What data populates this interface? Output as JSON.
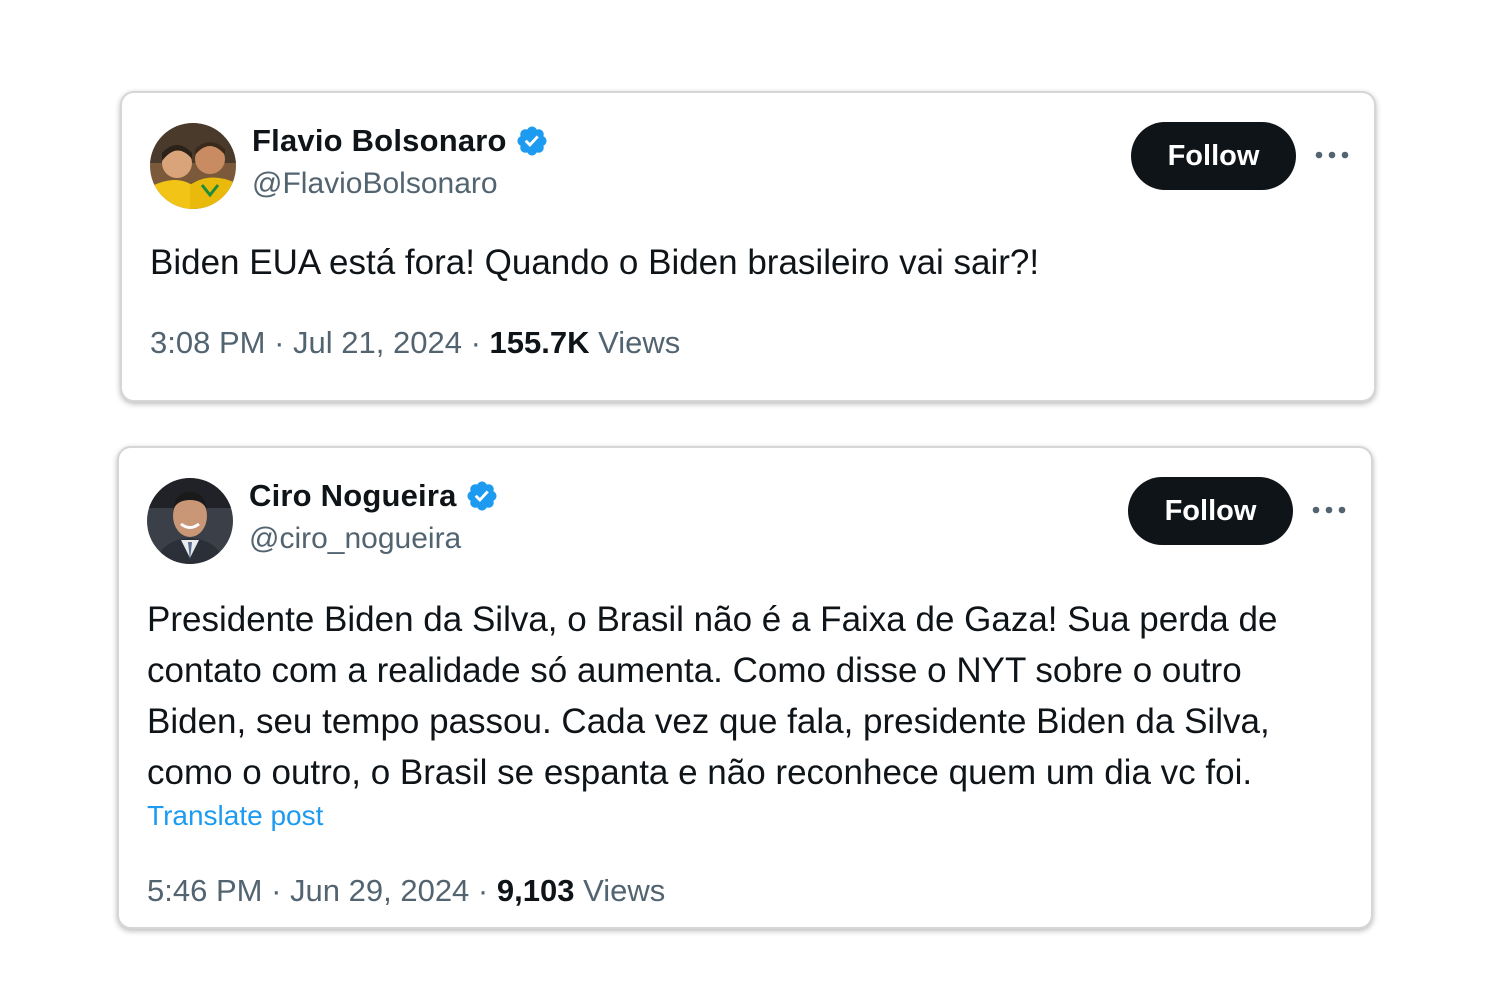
{
  "tweets": [
    {
      "display_name": "Flavio Bolsonaro",
      "handle": "@FlavioBolsonaro",
      "follow_label": "Follow",
      "text": "Biden EUA está fora! Quando o Biden brasileiro vai sair?!",
      "time": "3:08 PM",
      "separator": "·",
      "date": "Jul 21, 2024",
      "views_count": "155.7K",
      "views_label": "Views"
    },
    {
      "display_name": "Ciro Nogueira",
      "handle": "@ciro_nogueira",
      "follow_label": "Follow",
      "text": "Presidente Biden da Silva, o Brasil não é a Faixa de Gaza! Sua perda de contato com a realidade só aumenta. Como disse o NYT sobre o outro Biden, seu tempo passou. Cada vez que fala, presidente Biden da Silva, como o outro, o Brasil se espanta e não reconhece quem um dia vc foi.",
      "translate_label": "Translate post",
      "time": "5:46 PM",
      "separator": "·",
      "date": "Jun 29, 2024",
      "views_count": "9,103",
      "views_label": "Views"
    }
  ],
  "icons": {
    "verified": "verified-badge-icon",
    "more": "more-horizontal-icon"
  },
  "colors": {
    "text_primary": "#0f1419",
    "text_secondary": "#536471",
    "verified_blue": "#1d9bf0",
    "link_blue": "#1d9bf0",
    "follow_button_bg": "#0f1419"
  }
}
